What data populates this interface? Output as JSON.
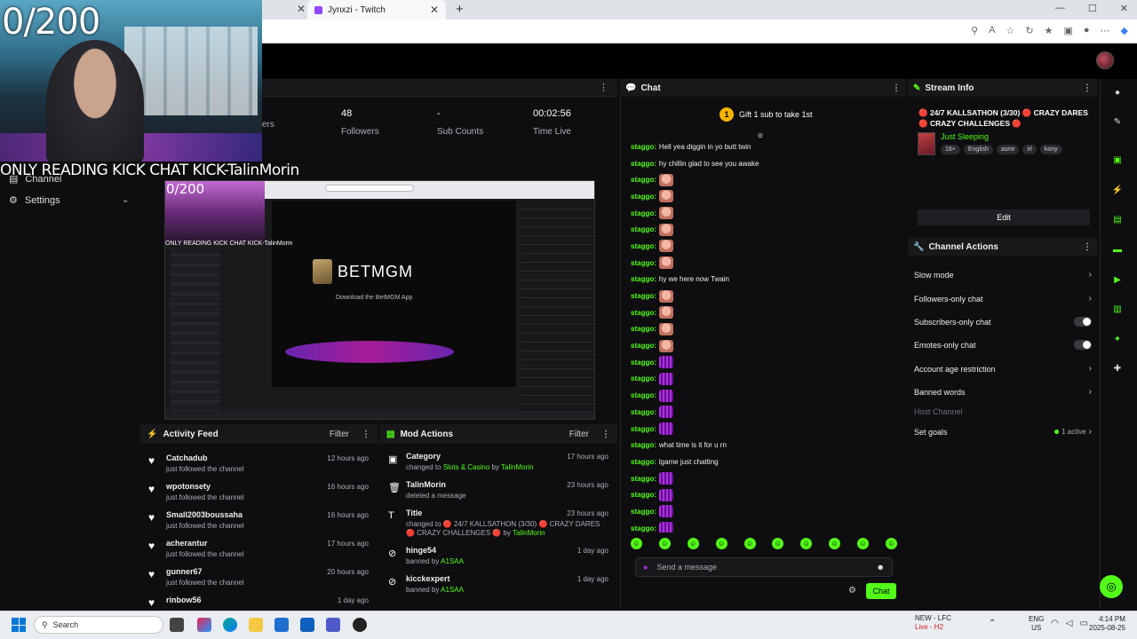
{
  "browser": {
    "tab_title": "Jynxzi - Twitch",
    "new_tab": "+",
    "close": "✕"
  },
  "overlay": {
    "sub_goal": "0/200",
    "banner": "ONLY READING KICK CHAT KICK-TalinMorin"
  },
  "sidebar": {
    "channel_label": "Channel",
    "settings_label": "Settings"
  },
  "stats": {
    "items": [
      {
        "value": "",
        "label": "ers"
      },
      {
        "value": "48",
        "label": "Followers"
      },
      {
        "value": "-",
        "label": "Sub Counts"
      },
      {
        "value": "00:02:56",
        "label": "Time Live"
      }
    ]
  },
  "preview": {
    "sub_goal": "0/200",
    "overlay": "ONLY READING KICK CHAT KICK-TalinMorin",
    "brand": "BETMGM",
    "brand_sub": "Download the BetMGM App"
  },
  "activity": {
    "title": "Activity Feed",
    "filter": "Filter",
    "items": [
      {
        "name": "Catchadub",
        "desc": "just followed the channel",
        "time": "12 hours ago"
      },
      {
        "name": "wpotonsety",
        "desc": "just followed the channel",
        "time": "16 hours ago"
      },
      {
        "name": "Small2003boussaha",
        "desc": "just followed the channel",
        "time": "16 hours ago"
      },
      {
        "name": "acherantur",
        "desc": "just followed the channel",
        "time": "17 hours ago"
      },
      {
        "name": "gunner67",
        "desc": "just followed the channel",
        "time": "20 hours ago"
      },
      {
        "name": "rinbow56",
        "desc": "",
        "time": "1 day ago"
      }
    ]
  },
  "mod_actions": {
    "title": "Mod Actions",
    "filter": "Filter",
    "items": [
      {
        "name": "Category",
        "desc_pre": "changed to ",
        "desc_hl1": "Slots & Casino",
        "desc_mid": " by ",
        "desc_hl2": "TalinMorin",
        "time": "17 hours ago"
      },
      {
        "name": "TalinMorin",
        "desc_pre": "deleted a message",
        "desc_hl1": "",
        "desc_mid": "",
        "desc_hl2": "",
        "time": "23 hours ago"
      },
      {
        "name": "Title",
        "desc_pre": "changed to 🔴 24/7 KALLSATHON (3/30) 🔴 CRAZY DARES 🔴 CRAZY CHALLENGES 🔴",
        "desc_hl1": "",
        "desc_mid": " by ",
        "desc_hl2": "TalinMorin",
        "time": "23 hours ago"
      },
      {
        "name": "hinge54",
        "desc_pre": "banned by ",
        "desc_hl1": "A1SAA",
        "desc_mid": "",
        "desc_hl2": "",
        "time": "1 day ago"
      },
      {
        "name": "kicckexpert",
        "desc_pre": "banned by ",
        "desc_hl1": "A1SAA",
        "desc_mid": "",
        "desc_hl2": "",
        "time": "1 day ago"
      }
    ]
  },
  "chat": {
    "title": "Chat",
    "gift_text": "Gift 1 sub to take 1st",
    "messages": [
      {
        "user": "staggo:",
        "text": "Hell yea diggin in yo butt twin",
        "emote": ""
      },
      {
        "user": "staggo:",
        "text": "hy chillin glad to see you awake",
        "emote": ""
      },
      {
        "user": "staggo:",
        "text": "",
        "emote": "face"
      },
      {
        "user": "staggo:",
        "text": "",
        "emote": "face"
      },
      {
        "user": "staggo:",
        "text": "",
        "emote": "face"
      },
      {
        "user": "staggo:",
        "text": "",
        "emote": "face"
      },
      {
        "user": "staggo:",
        "text": "",
        "emote": "face"
      },
      {
        "user": "staggo:",
        "text": "",
        "emote": "face"
      },
      {
        "user": "staggo:",
        "text": "hy we here now Twain",
        "emote": ""
      },
      {
        "user": "staggo:",
        "text": "",
        "emote": "face"
      },
      {
        "user": "staggo:",
        "text": "",
        "emote": "face"
      },
      {
        "user": "staggo:",
        "text": "",
        "emote": "face"
      },
      {
        "user": "staggo:",
        "text": "",
        "emote": "face"
      },
      {
        "user": "staggo:",
        "text": "",
        "emote": "purple"
      },
      {
        "user": "staggo:",
        "text": "",
        "emote": "purple"
      },
      {
        "user": "staggo:",
        "text": "",
        "emote": "purple"
      },
      {
        "user": "staggo:",
        "text": "",
        "emote": "purple"
      },
      {
        "user": "staggo:",
        "text": "",
        "emote": "purple"
      },
      {
        "user": "staggo:",
        "text": "what time is it for u rn",
        "emote": ""
      },
      {
        "user": "staggo:",
        "text": "lgame just chatting",
        "emote": ""
      },
      {
        "user": "staggo:",
        "text": "",
        "emote": "purple"
      },
      {
        "user": "staggo:",
        "text": "",
        "emote": "purple"
      },
      {
        "user": "staggo:",
        "text": "",
        "emote": "purple"
      },
      {
        "user": "staggo:",
        "text": "",
        "emote": "purple"
      }
    ],
    "input_placeholder": "Send a message",
    "send_label": "Chat"
  },
  "stream_info": {
    "title": "Stream Info",
    "stream_title": "🔴 24/7 KALLSATHON (3/30) 🔴 CRAZY DARES 🔴 CRAZY CHALLENGES 🔴",
    "category": "Just Sleeping",
    "tags": [
      "18+",
      "English",
      "asmr",
      "irl",
      "kony"
    ],
    "edit_label": "Edit"
  },
  "channel_actions": {
    "title": "Channel Actions",
    "items": [
      {
        "label": "Slow mode",
        "control": "chevron"
      },
      {
        "label": "Followers-only chat",
        "control": "chevron"
      },
      {
        "label": "Subscribers-only chat",
        "control": "toggle"
      },
      {
        "label": "Emotes-only chat",
        "control": "toggle"
      },
      {
        "label": "Account age restriction",
        "control": "chevron"
      },
      {
        "label": "Banned words",
        "control": "chevron"
      },
      {
        "label": "Host Channel",
        "control": "none"
      },
      {
        "label": "Set goals",
        "control": "active"
      }
    ],
    "active_text": "1 active"
  },
  "taskbar": {
    "search_label": "Search",
    "news_title": "NEW - LFC",
    "news_sub": "Live - H2",
    "lang_top": "ENG",
    "lang_bottom": "US",
    "time": "4:14 PM",
    "date": "2025-08-25"
  },
  "colors": {
    "kick_green": "#53fc18",
    "bg": "#0e0e10",
    "panel": "#18181b"
  }
}
